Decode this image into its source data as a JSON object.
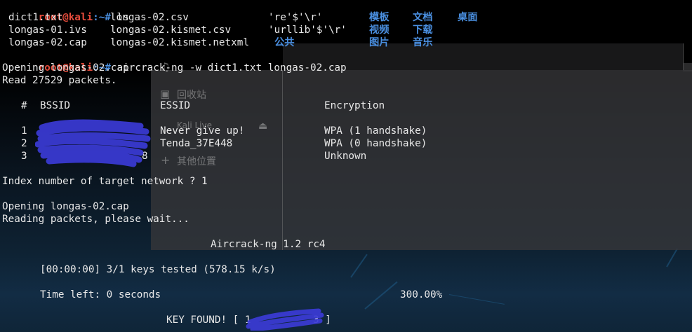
{
  "prompt": {
    "user": "root@kali",
    "path": ":~#"
  },
  "ls_cmd": " ls",
  "ls_output": {
    "col1": [
      "dict1.txt",
      "longas-01.ivs",
      "longas-02.cap"
    ],
    "col2": [
      "longas-02.csv",
      "longas-02.kismet.csv",
      "longas-02.kismet.netxml"
    ],
    "col3": [
      "'re'$'\\r'",
      "'urllib'$'\\r'",
      ""
    ],
    "dirs": [
      [
        "模板",
        "文档",
        "桌面"
      ],
      [
        "视频",
        "下载",
        ""
      ],
      [
        "公共",
        "图片",
        "音乐"
      ]
    ]
  },
  "aircrack_cmd": " aircrack-ng -w dict1.txt longas-02.cap",
  "output": {
    "opening1": "Opening longas-02.cap",
    "read": "Read 27529 packets.",
    "headers": {
      "num": "#",
      "bssid": "BSSID",
      "essid": "ESSID",
      "enc": "Encryption"
    },
    "networks": [
      {
        "num": "1",
        "essid": "Never give up!",
        "enc": "WPA (1 handshake)"
      },
      {
        "num": "2",
        "essid": "Tenda_37E448",
        "enc": "WPA (0 handshake)"
      },
      {
        "num": "3",
        "essid": "",
        "enc": "Unknown"
      }
    ],
    "bssid_trailing_digit": "8",
    "index_prompt": "Index number of target network ? 1",
    "opening2": "Opening longas-02.cap",
    "reading": "Reading packets, please wait...",
    "version": "Aircrack-ng 1.2 rc4",
    "keys_tested": "[00:00:00] 3/1 keys tested (578.15 k/s)",
    "time_left": "Time left: 0 seconds",
    "percent": "300.00%",
    "key_found_prefix": "KEY FOUND! [ 1",
    "key_found_suffix": "3 ]"
  },
  "background_window": {
    "items": [
      "回收站",
      "Kali Live",
      "其他位置"
    ]
  },
  "colors": {
    "prompt_user": "#e74c3c",
    "prompt_path": "#4a8fe0",
    "redaction": "#3b3bd6"
  }
}
